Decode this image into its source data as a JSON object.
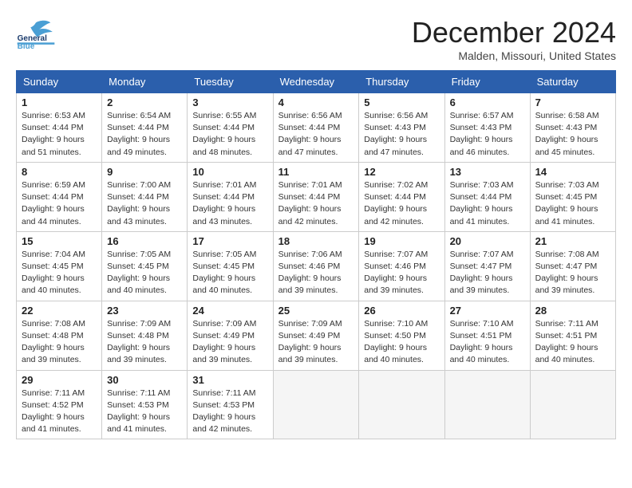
{
  "header": {
    "logo_general": "General",
    "logo_blue": "Blue",
    "month_title": "December 2024",
    "location": "Malden, Missouri, United States"
  },
  "days_of_week": [
    "Sunday",
    "Monday",
    "Tuesday",
    "Wednesday",
    "Thursday",
    "Friday",
    "Saturday"
  ],
  "weeks": [
    [
      {
        "day": 1,
        "sunrise": "6:53 AM",
        "sunset": "4:44 PM",
        "daylight": "9 hours and 51 minutes."
      },
      {
        "day": 2,
        "sunrise": "6:54 AM",
        "sunset": "4:44 PM",
        "daylight": "9 hours and 49 minutes."
      },
      {
        "day": 3,
        "sunrise": "6:55 AM",
        "sunset": "4:44 PM",
        "daylight": "9 hours and 48 minutes."
      },
      {
        "day": 4,
        "sunrise": "6:56 AM",
        "sunset": "4:44 PM",
        "daylight": "9 hours and 47 minutes."
      },
      {
        "day": 5,
        "sunrise": "6:56 AM",
        "sunset": "4:43 PM",
        "daylight": "9 hours and 47 minutes."
      },
      {
        "day": 6,
        "sunrise": "6:57 AM",
        "sunset": "4:43 PM",
        "daylight": "9 hours and 46 minutes."
      },
      {
        "day": 7,
        "sunrise": "6:58 AM",
        "sunset": "4:43 PM",
        "daylight": "9 hours and 45 minutes."
      }
    ],
    [
      {
        "day": 8,
        "sunrise": "6:59 AM",
        "sunset": "4:44 PM",
        "daylight": "9 hours and 44 minutes."
      },
      {
        "day": 9,
        "sunrise": "7:00 AM",
        "sunset": "4:44 PM",
        "daylight": "9 hours and 43 minutes."
      },
      {
        "day": 10,
        "sunrise": "7:01 AM",
        "sunset": "4:44 PM",
        "daylight": "9 hours and 43 minutes."
      },
      {
        "day": 11,
        "sunrise": "7:01 AM",
        "sunset": "4:44 PM",
        "daylight": "9 hours and 42 minutes."
      },
      {
        "day": 12,
        "sunrise": "7:02 AM",
        "sunset": "4:44 PM",
        "daylight": "9 hours and 42 minutes."
      },
      {
        "day": 13,
        "sunrise": "7:03 AM",
        "sunset": "4:44 PM",
        "daylight": "9 hours and 41 minutes."
      },
      {
        "day": 14,
        "sunrise": "7:03 AM",
        "sunset": "4:45 PM",
        "daylight": "9 hours and 41 minutes."
      }
    ],
    [
      {
        "day": 15,
        "sunrise": "7:04 AM",
        "sunset": "4:45 PM",
        "daylight": "9 hours and 40 minutes."
      },
      {
        "day": 16,
        "sunrise": "7:05 AM",
        "sunset": "4:45 PM",
        "daylight": "9 hours and 40 minutes."
      },
      {
        "day": 17,
        "sunrise": "7:05 AM",
        "sunset": "4:45 PM",
        "daylight": "9 hours and 40 minutes."
      },
      {
        "day": 18,
        "sunrise": "7:06 AM",
        "sunset": "4:46 PM",
        "daylight": "9 hours and 39 minutes."
      },
      {
        "day": 19,
        "sunrise": "7:07 AM",
        "sunset": "4:46 PM",
        "daylight": "9 hours and 39 minutes."
      },
      {
        "day": 20,
        "sunrise": "7:07 AM",
        "sunset": "4:47 PM",
        "daylight": "9 hours and 39 minutes."
      },
      {
        "day": 21,
        "sunrise": "7:08 AM",
        "sunset": "4:47 PM",
        "daylight": "9 hours and 39 minutes."
      }
    ],
    [
      {
        "day": 22,
        "sunrise": "7:08 AM",
        "sunset": "4:48 PM",
        "daylight": "9 hours and 39 minutes."
      },
      {
        "day": 23,
        "sunrise": "7:09 AM",
        "sunset": "4:48 PM",
        "daylight": "9 hours and 39 minutes."
      },
      {
        "day": 24,
        "sunrise": "7:09 AM",
        "sunset": "4:49 PM",
        "daylight": "9 hours and 39 minutes."
      },
      {
        "day": 25,
        "sunrise": "7:09 AM",
        "sunset": "4:49 PM",
        "daylight": "9 hours and 39 minutes."
      },
      {
        "day": 26,
        "sunrise": "7:10 AM",
        "sunset": "4:50 PM",
        "daylight": "9 hours and 40 minutes."
      },
      {
        "day": 27,
        "sunrise": "7:10 AM",
        "sunset": "4:51 PM",
        "daylight": "9 hours and 40 minutes."
      },
      {
        "day": 28,
        "sunrise": "7:11 AM",
        "sunset": "4:51 PM",
        "daylight": "9 hours and 40 minutes."
      }
    ],
    [
      {
        "day": 29,
        "sunrise": "7:11 AM",
        "sunset": "4:52 PM",
        "daylight": "9 hours and 41 minutes."
      },
      {
        "day": 30,
        "sunrise": "7:11 AM",
        "sunset": "4:53 PM",
        "daylight": "9 hours and 41 minutes."
      },
      {
        "day": 31,
        "sunrise": "7:11 AM",
        "sunset": "4:53 PM",
        "daylight": "9 hours and 42 minutes."
      },
      null,
      null,
      null,
      null
    ]
  ],
  "labels": {
    "sunrise": "Sunrise:",
    "sunset": "Sunset:",
    "daylight": "Daylight:"
  }
}
